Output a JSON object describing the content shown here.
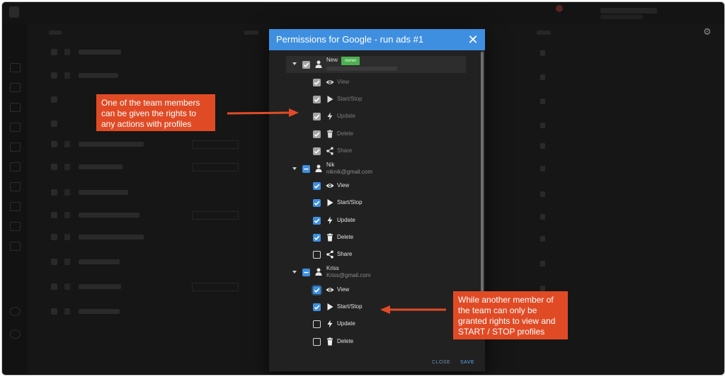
{
  "dialog": {
    "title": "Permissions for Google - run ads #1",
    "close_label": "CLOSE",
    "save_label": "SAVE"
  },
  "users": [
    {
      "name": "New",
      "badge": "owner",
      "email": "",
      "state": "inherited",
      "permissions": [
        {
          "label": "View",
          "checked": true,
          "icon": "eye-icon"
        },
        {
          "label": "Start/Stop",
          "checked": true,
          "icon": "play-icon"
        },
        {
          "label": "Update",
          "checked": true,
          "icon": "lightning-icon"
        },
        {
          "label": "Delete",
          "checked": true,
          "icon": "trash-icon"
        },
        {
          "label": "Share",
          "checked": true,
          "icon": "share-icon"
        }
      ]
    },
    {
      "name": "Nik",
      "email": "niknik@gmail.com",
      "state": "partial",
      "permissions": [
        {
          "label": "View",
          "checked": true,
          "icon": "eye-icon"
        },
        {
          "label": "Start/Stop",
          "checked": true,
          "icon": "play-icon"
        },
        {
          "label": "Update",
          "checked": true,
          "icon": "lightning-icon"
        },
        {
          "label": "Delete",
          "checked": true,
          "icon": "trash-icon"
        },
        {
          "label": "Share",
          "checked": false,
          "icon": "share-icon"
        }
      ]
    },
    {
      "name": "Kriss",
      "email": "Kriss@gmail.com",
      "state": "partial",
      "permissions": [
        {
          "label": "View",
          "checked": true,
          "icon": "eye-icon"
        },
        {
          "label": "Start/Stop",
          "checked": true,
          "icon": "play-icon"
        },
        {
          "label": "Update",
          "checked": false,
          "icon": "lightning-icon"
        },
        {
          "label": "Delete",
          "checked": false,
          "icon": "trash-icon"
        }
      ]
    }
  ],
  "annotations": {
    "left": "One of the team members can be given the rights to any actions with profiles",
    "right": "While another member of the team can only be granted rights to view and START / STOP profiles"
  },
  "colors": {
    "accent": "#3f8fe0",
    "annotation": "#e04b26",
    "owner_badge": "#4caf50",
    "dialog_bg": "#212121"
  }
}
